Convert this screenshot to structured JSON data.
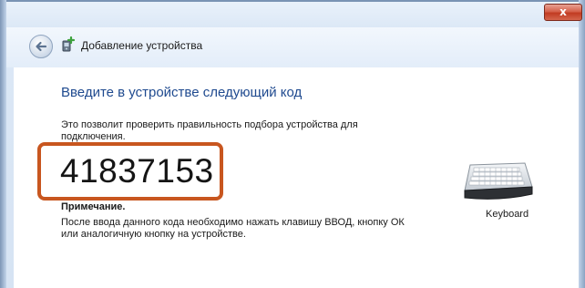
{
  "window": {
    "title": "Добавление устройства",
    "close_label": "x"
  },
  "icons": {
    "back": "back-arrow-icon",
    "device": "add-device-icon",
    "keyboard": "keyboard-icon"
  },
  "main": {
    "instruction": "Введите в устройстве следующий код",
    "description": "Это позволит проверить правильность подбора устройства для подключения.",
    "code": "41837153",
    "note_title": "Примечание.",
    "note_text": "После ввода данного кода необходимо нажать клавишу ВВОД, кнопку ОК или аналогичную кнопку на устройстве."
  },
  "device": {
    "label": "Keyboard"
  },
  "colors": {
    "instruction": "#1f4a8f",
    "highlight_border": "#c8561f",
    "close_button": "#c13b22"
  }
}
